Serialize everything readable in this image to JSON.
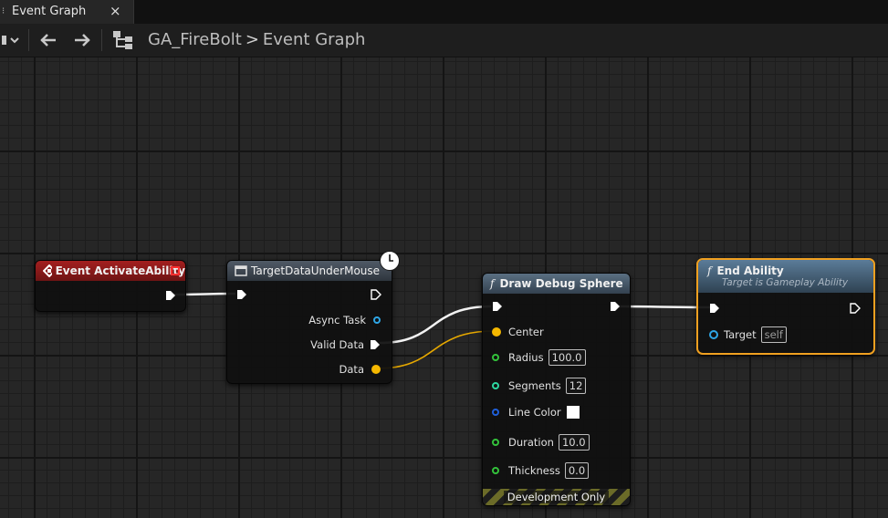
{
  "tab": {
    "title": "Event Graph",
    "close_label": "×"
  },
  "breadcrumb": {
    "asset": "GA_FireBolt",
    "separator": ">",
    "graph": "Event Graph"
  },
  "colors": {
    "event_header": "#8b1a1a",
    "exec": "#ffffff",
    "struct_pin": "#f5b800",
    "float_pin": "#33c23b",
    "int_pin": "#2dd6a0",
    "color_pin": "#1f5fd9",
    "object_pin": "#2ea6e6",
    "selection": "#f0a020"
  },
  "nodes": {
    "event": {
      "title": "Event ActivateAbility"
    },
    "target_data": {
      "title": "TargetDataUnderMouse",
      "pins": {
        "async_task": "Async Task",
        "valid_data": "Valid Data",
        "data": "Data"
      }
    },
    "draw_sphere": {
      "title": "Draw Debug Sphere",
      "func_icon": "f",
      "pins": {
        "center": "Center",
        "radius": "Radius",
        "radius_value": "100.0",
        "segments": "Segments",
        "segments_value": "12",
        "line_color": "Line Color",
        "duration": "Duration",
        "duration_value": "10.0",
        "thickness": "Thickness",
        "thickness_value": "0.0"
      },
      "footer": "Development Only"
    },
    "end_ability": {
      "title": "End Ability",
      "subtitle": "Target is Gameplay Ability",
      "func_icon": "f",
      "pins": {
        "target": "Target",
        "target_value": "self"
      }
    }
  }
}
